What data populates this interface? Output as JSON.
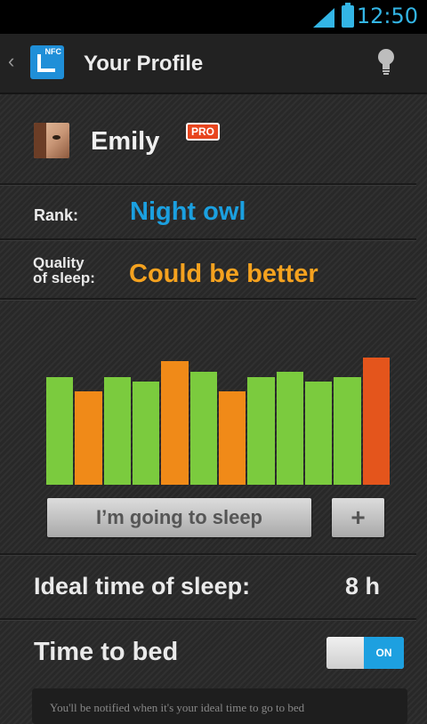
{
  "status_bar": {
    "time": "12:50"
  },
  "action_bar": {
    "logo_text": "NFC",
    "title": "Your Profile"
  },
  "profile": {
    "name": "Emily",
    "badge": "PRO"
  },
  "rank": {
    "label": "Rank:",
    "value": "Night owl"
  },
  "quality": {
    "label_line1": "Quality",
    "label_line2": "of sleep:",
    "value": "Could be better"
  },
  "chart_data": {
    "type": "bar",
    "categories": [],
    "values": [
      121,
      105,
      121,
      116,
      139,
      127,
      105,
      121,
      127,
      116,
      121,
      143
    ],
    "colors": [
      "#7bcb3e",
      "#f08a18",
      "#7bcb3e",
      "#7bcb3e",
      "#f08a18",
      "#7bcb3e",
      "#f08a18",
      "#7bcb3e",
      "#7bcb3e",
      "#7bcb3e",
      "#7bcb3e",
      "#e4551c"
    ],
    "max": 155
  },
  "buttons": {
    "sleep": "I’m going to sleep",
    "plus": "+"
  },
  "ideal": {
    "label": "Ideal time of sleep:",
    "value": "8 h"
  },
  "bed": {
    "label": "Time to bed",
    "toggle_state": "ON"
  },
  "hint": {
    "text": "You'll be notified when it's your ideal time to go to bed"
  },
  "colors": {
    "accent": "#1ba0e0",
    "warning": "#f5a21f"
  }
}
